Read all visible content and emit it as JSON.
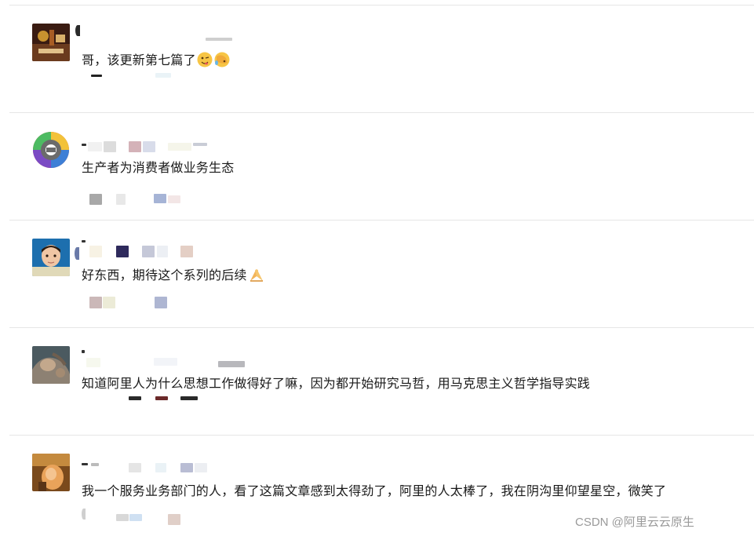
{
  "comments": [
    {
      "text": "哥，该更新第七篇了",
      "emojis": [
        "wink-tongue-emoji",
        "facepalm-emoji"
      ]
    },
    {
      "text": "生产者为消费者做业务生态",
      "emojis": []
    },
    {
      "text": "好东西，期待这个系列的后续",
      "emojis": [
        "praying-hands-emoji"
      ]
    },
    {
      "text": "知道阿里人为什么思想工作做得好了嘛，因为都开始研究马哲，用马克思主义哲学指导实践",
      "emojis": []
    },
    {
      "text": "我一个服务业务部门的人，看了这篇文章感到太得劲了，阿里的人太棒了，我在阴沟里仰望星空，微笑了",
      "emojis": []
    }
  ],
  "watermark": "CSDN @阿里云云原生"
}
